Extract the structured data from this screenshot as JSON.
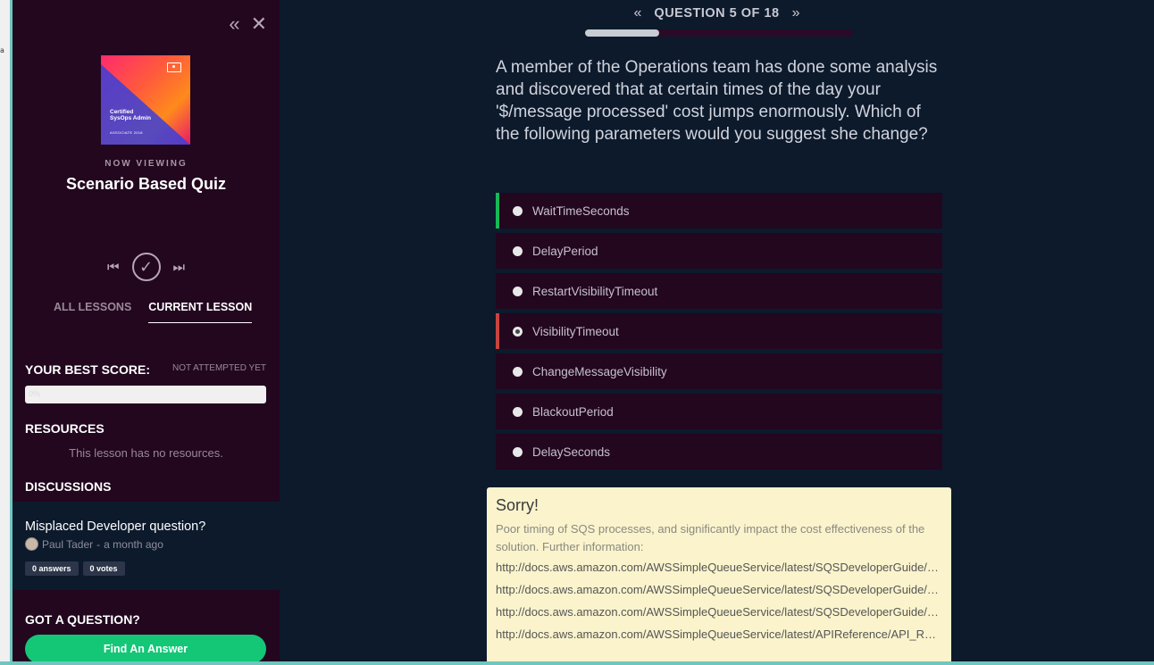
{
  "sidebar": {
    "collapse_icon": "double-chevron-left",
    "close_icon": "close",
    "course_card": {
      "title_line1": "Certified",
      "title_line2": "SysOps Admin",
      "subtitle": "ASSOCIATE 2018"
    },
    "now_viewing_label": "NOW VIEWING",
    "lesson_title": "Scenario Based Quiz",
    "tabs": [
      {
        "label": "ALL LESSONS",
        "active": false
      },
      {
        "label": "CURRENT LESSON",
        "active": true
      }
    ],
    "best_score_label": "YOUR BEST SCORE:",
    "best_score_status": "NOT ATTEMPTED YET",
    "best_score_value": "0%",
    "resources_label": "RESOURCES",
    "resources_empty": "This lesson has no resources.",
    "discussions_label": "DISCUSSIONS",
    "discussion": {
      "title": "Misplaced Developer question?",
      "author": "Paul Tader",
      "time": "a month ago",
      "answers": "0 answers",
      "votes": "0 votes"
    },
    "got_question_label": "GOT A QUESTION?",
    "find_answer_button": "Find An Answer"
  },
  "quiz": {
    "question_counter": "QUESTION 5 OF 18",
    "progress_fraction": 0.278,
    "question": "A member of the Operations team has done some analysis and discovered that at certain times of the day your '$/message processed' cost jumps enormously. Which of the following parameters would you suggest she change?",
    "options": [
      {
        "label": "WaitTimeSeconds",
        "state": "correct"
      },
      {
        "label": "DelayPeriod",
        "state": "none"
      },
      {
        "label": "RestartVisibilityTimeout",
        "state": "none"
      },
      {
        "label": "VisibilityTimeout",
        "state": "wrong"
      },
      {
        "label": "ChangeMessageVisibility",
        "state": "none"
      },
      {
        "label": "BlackoutPeriod",
        "state": "none"
      },
      {
        "label": "DelaySeconds",
        "state": "none"
      }
    ],
    "feedback": {
      "heading": "Sorry!",
      "body": "Poor timing of SQS processes, and significantly impact the cost effectiveness of the solution. Further information:",
      "links": [
        "http://docs.aws.amazon.com/AWSSimpleQueueService/latest/SQSDeveloperGuide/sqs-long-polling.html",
        "http://docs.aws.amazon.com/AWSSimpleQueueService/latest/SQSDeveloperGuide/sqs-delay-queues.html",
        "http://docs.aws.amazon.com/AWSSimpleQueueService/latest/SQSDeveloperGuide/sqs-visibility-timeout.html",
        "http://docs.aws.amazon.com/AWSSimpleQueueService/latest/APIReference/API_ReceiveMessage.html"
      ]
    }
  },
  "colors": {
    "correct": "#17b857",
    "wrong": "#c8433f"
  }
}
